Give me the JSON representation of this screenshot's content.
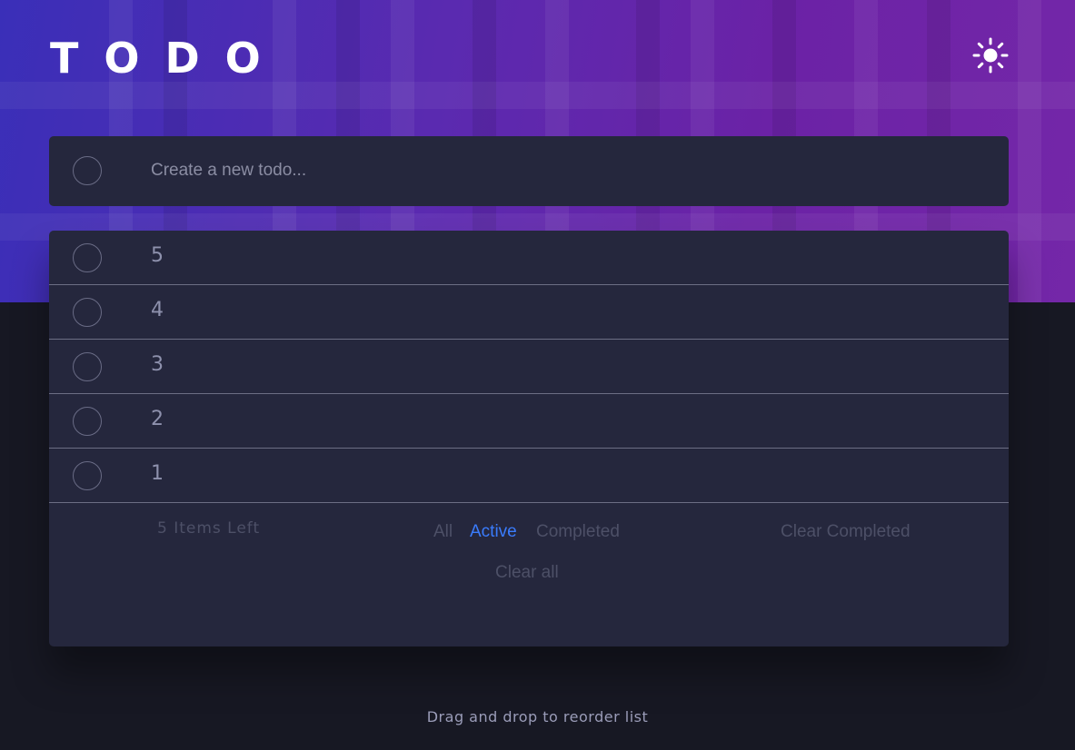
{
  "app": {
    "title": "TODO",
    "theme_icon": "sun-icon"
  },
  "new_todo": {
    "placeholder": "Create a new todo...",
    "value": ""
  },
  "todos": [
    {
      "label": "5",
      "completed": false
    },
    {
      "label": "4",
      "completed": false
    },
    {
      "label": "3",
      "completed": false
    },
    {
      "label": "2",
      "completed": false
    },
    {
      "label": "1",
      "completed": false
    }
  ],
  "footer": {
    "items_left": "5 Items Left",
    "filters": [
      "All",
      "Active",
      "Completed"
    ],
    "active_filter": "Active",
    "clear_completed": "Clear Completed",
    "clear_all": "Clear all"
  },
  "hint": "Drag and drop to reorder list",
  "colors": {
    "background": "#171823",
    "card": "#25273d",
    "accent": "#3a7cfd",
    "hero_start": "#3a2fb8",
    "hero_end": "#7427a8"
  }
}
